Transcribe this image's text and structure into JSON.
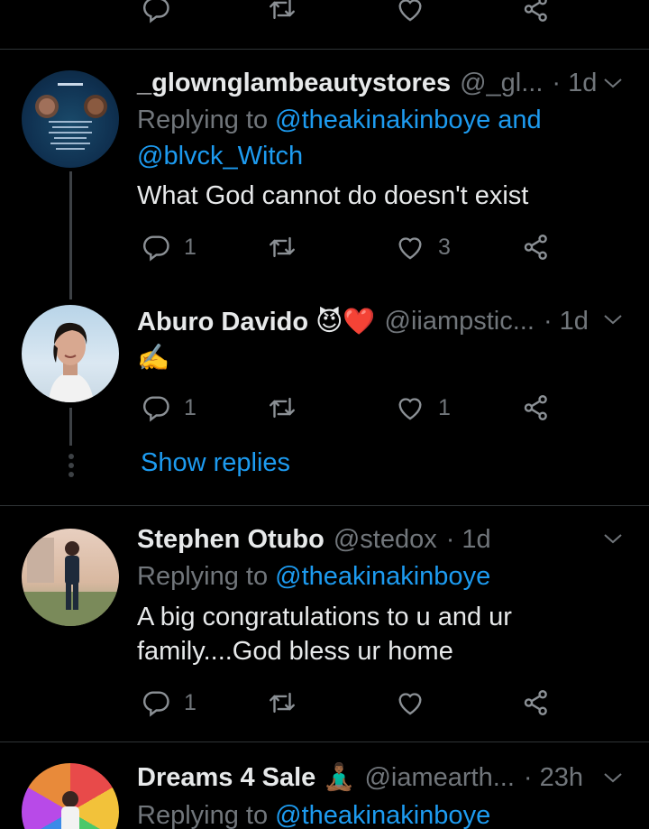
{
  "top_actions": {
    "reply_count": "",
    "retweet_count": "",
    "like_count": ""
  },
  "tweets": [
    {
      "name": "_glownglambeautystores",
      "handle": "@_gl...",
      "time": "· 1d",
      "replying_prefix": "Replying to ",
      "replying_to_1": "@theakinakinboye",
      "replying_and": " and",
      "replying_to_2": "@blvck_Witch",
      "text": "What God cannot do doesn't exist",
      "reply_count": "1",
      "retweet_count": "",
      "like_count": "3"
    },
    {
      "name": "Aburo Davido 😈❤️",
      "handle": "@iiampstic...",
      "time": "· 1d",
      "text": "✍️",
      "reply_count": "1",
      "retweet_count": "",
      "like_count": "1",
      "show_replies": "Show replies"
    },
    {
      "name": "Stephen Otubo",
      "handle": "@stedox",
      "time": "· 1d",
      "replying_prefix": "Replying to ",
      "replying_to_1": "@theakinakinboye",
      "text_line1": "A big congratulations to u and ur",
      "text_line2": "family....God bless ur home",
      "reply_count": "1",
      "retweet_count": "",
      "like_count": ""
    },
    {
      "name": "Dreams 4 Sale 🧘🏾‍♂️",
      "handle": "@iamearth...",
      "time": "· 23h",
      "replying_prefix": "Replying to ",
      "replying_to_1": "@theakinakinboye"
    }
  ],
  "icons": {
    "reply": "reply-icon",
    "retweet": "retweet-icon",
    "like": "heart-icon",
    "share": "share-icon",
    "more": "chevron-down-icon"
  },
  "colors": {
    "background": "#000000",
    "accent": "#1d9bf0",
    "muted": "#71767b",
    "text": "#e7e9ea"
  }
}
